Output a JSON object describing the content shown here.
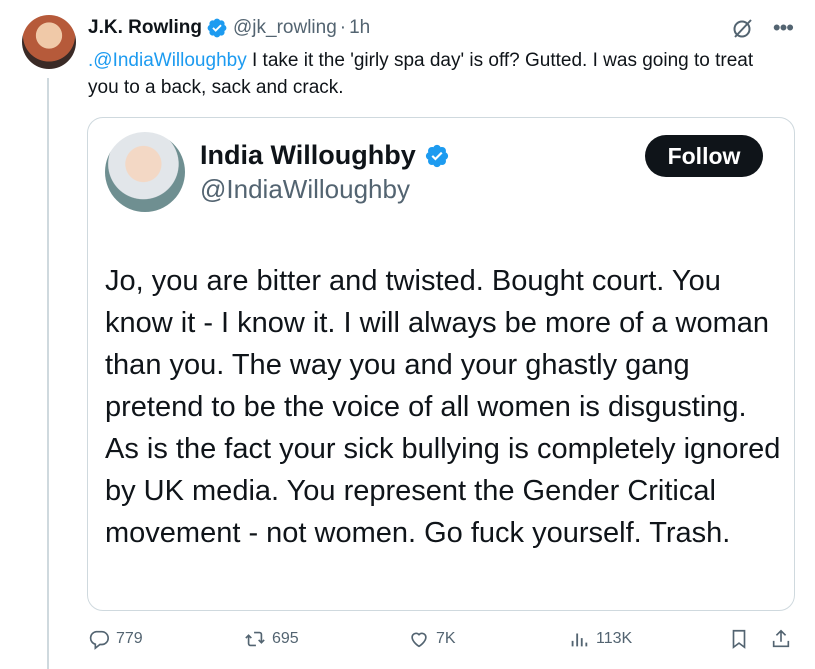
{
  "tweet": {
    "author_name": "J.K. Rowling",
    "author_handle": "@jk_rowling",
    "separator": "·",
    "time": "1h",
    "mention": ".@IndiaWilloughby",
    "text": " I take it the 'girly spa day' is off? Gutted. I was going to treat you to a back, sack and crack."
  },
  "quoted": {
    "name": "India Willoughby",
    "handle": "@IndiaWilloughby",
    "follow_label": "Follow",
    "body": "Jo, you are bitter and twisted. Bought court. You know it - I know it. I will always be more of a woman than you. The way you and your ghastly gang pretend to be the voice of all women is disgusting. As is the fact your sick bullying is completely ignored by UK media. You represent the Gender Critical movement - not women.  Go fuck yourself. Trash."
  },
  "actions": {
    "replies": "779",
    "reposts": "695",
    "likes": "7K",
    "views": "113K"
  },
  "icons": {
    "verified": "verified-badge-icon",
    "grok": "grok-icon",
    "more": "more-icon",
    "reply": "reply-icon",
    "repost": "repost-icon",
    "like": "like-icon",
    "views": "views-icon",
    "bookmark": "bookmark-icon",
    "share": "share-icon"
  },
  "colors": {
    "accent": "#1d9bf0",
    "muted": "#536471",
    "text": "#0f1419",
    "border": "#cfd9de"
  }
}
